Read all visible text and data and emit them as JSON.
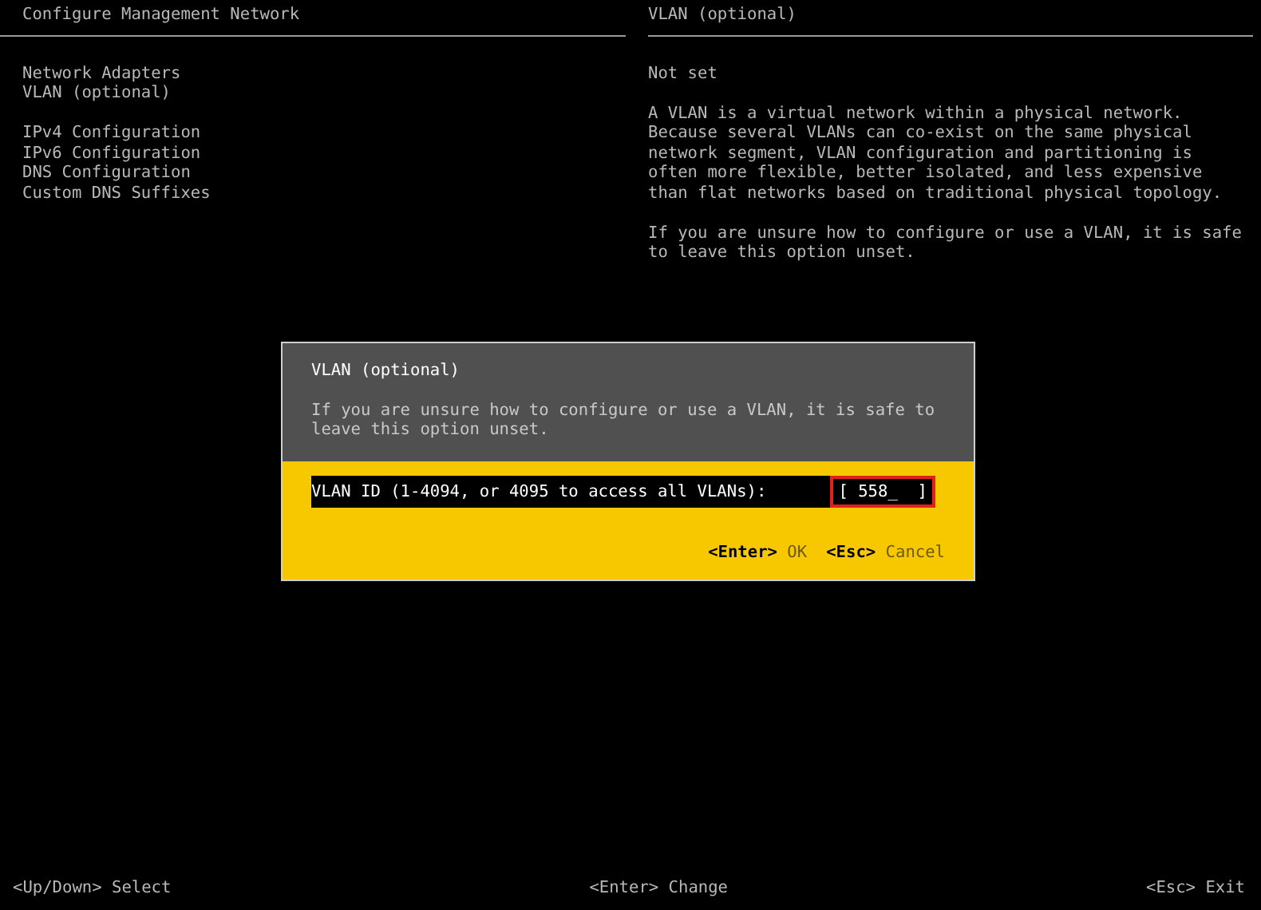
{
  "left_panel": {
    "title": "Configure Management Network",
    "menu_groups": [
      [
        "Network Adapters",
        "VLAN (optional)"
      ],
      [
        "IPv4 Configuration",
        "IPv6 Configuration",
        "DNS Configuration",
        "Custom DNS Suffixes"
      ]
    ]
  },
  "right_panel": {
    "title": "VLAN (optional)",
    "status": "Not set",
    "paragraphs": [
      "A VLAN is a virtual network within a physical network.\nBecause several VLANs can co-exist on the same physical\nnetwork segment, VLAN configuration and partitioning is\noften more flexible, better isolated, and less expensive\nthan flat networks based on traditional physical topology.",
      "If you are unsure how to configure or use a VLAN, it is safe\nto leave this option unset."
    ]
  },
  "dialog": {
    "title": "VLAN (optional)",
    "description": "If you are unsure how to configure or use a VLAN, it is safe to\nleave this option unset.",
    "field_label": "VLAN ID (1-4094, or 4095 to access all VLANs):",
    "field_value": "[ 558_  ]",
    "actions": [
      {
        "key": "<Enter>",
        "label": "OK"
      },
      {
        "key": "<Esc>",
        "label": "Cancel"
      }
    ]
  },
  "status_bar": [
    {
      "key": "<Up/Down>",
      "label": "Select"
    },
    {
      "key": "<Enter>",
      "label": "Change"
    },
    {
      "key": "<Esc>",
      "label": "Exit"
    }
  ]
}
